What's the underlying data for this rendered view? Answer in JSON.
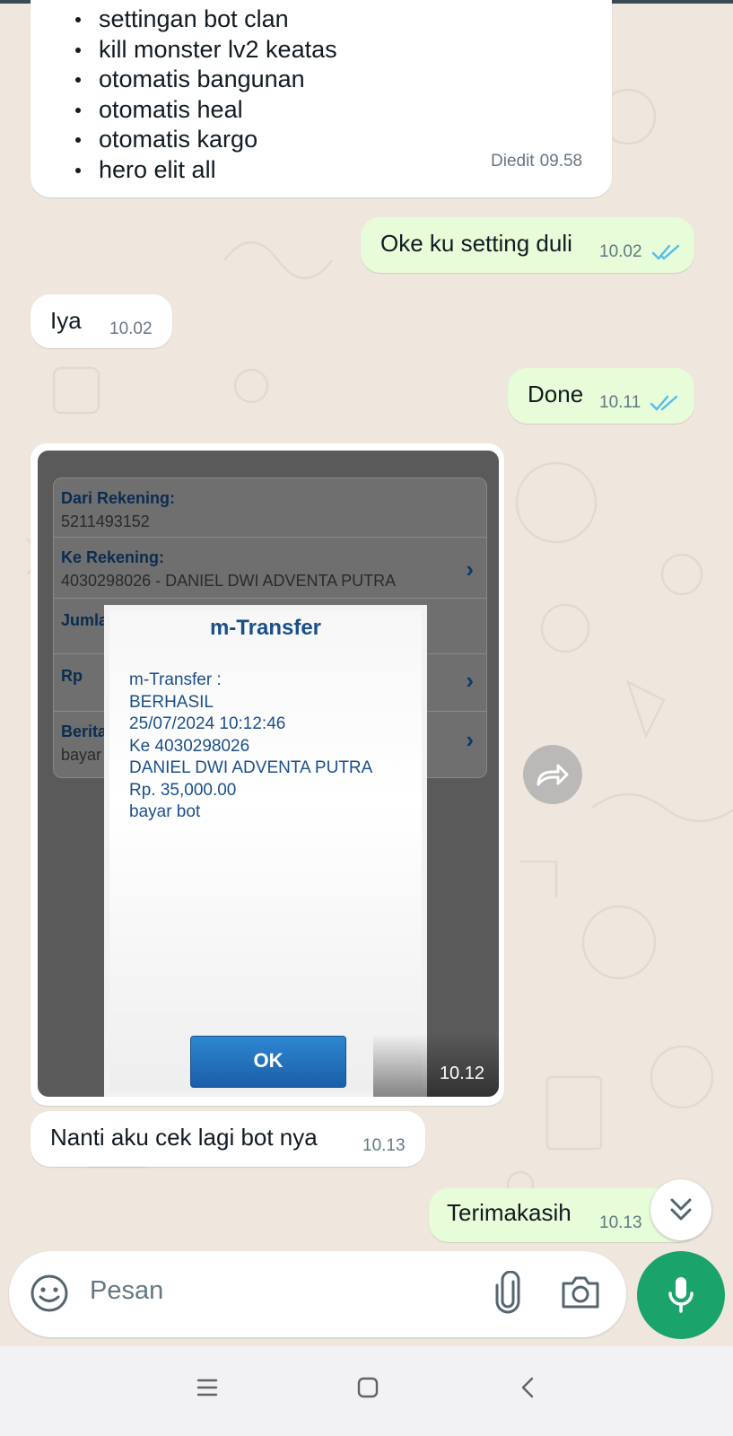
{
  "colors": {
    "wallpaper": "#efe7de",
    "incoming_bubble": "#ffffff",
    "outgoing_bubble": "#e7fcd8",
    "read_ticks": "#53bdeb",
    "accent": "#1aa36b"
  },
  "messages": [
    {
      "direction": "in",
      "items": [
        "settingan bot clan",
        "kill monster lv2 keatas",
        "otomatis bangunan",
        "otomatis heal",
        "otomatis kargo",
        "hero elit all"
      ],
      "edited_label": "Diedit",
      "time": "09.58"
    },
    {
      "direction": "out",
      "text": "Oke ku setting duli",
      "time": "10.02",
      "status": "read"
    },
    {
      "direction": "in",
      "text": "Iya",
      "time": "10.02"
    },
    {
      "direction": "out",
      "text": "Done",
      "time": "10.11",
      "status": "read"
    },
    {
      "direction": "in",
      "type": "image",
      "time": "10.12",
      "image": {
        "rows": [
          {
            "label": "Dari Rekening:",
            "value": "5211493152"
          },
          {
            "label": "Ke Rekening:",
            "value": "4030298026 - DANIEL DWI ADVENTA PUTRA"
          },
          {
            "label": "Jumla",
            "value": ""
          },
          {
            "label": "Rp",
            "value": ""
          },
          {
            "label": "Berita",
            "value": "bayar"
          }
        ],
        "dialog": {
          "title": "m-Transfer",
          "lines": [
            "m-Transfer :",
            "BERHASIL",
            "25/07/2024 10:12:46",
            "Ke 4030298026",
            "DANIEL DWI ADVENTA PUTRA",
            "Rp. 35,000.00",
            "bayar bot"
          ],
          "button": "OK"
        }
      }
    },
    {
      "direction": "in",
      "text": "Nanti aku cek lagi bot nya",
      "time": "10.13"
    },
    {
      "direction": "out",
      "text": "Terimakasih",
      "time": "10.13",
      "status": "sent"
    }
  ],
  "composer": {
    "placeholder": "Pesan",
    "icons": [
      "emoji-icon",
      "paperclip-icon",
      "camera-icon",
      "mic-icon"
    ]
  },
  "navbar": {
    "icons": [
      "recent-apps-icon",
      "home-icon",
      "back-icon"
    ]
  }
}
